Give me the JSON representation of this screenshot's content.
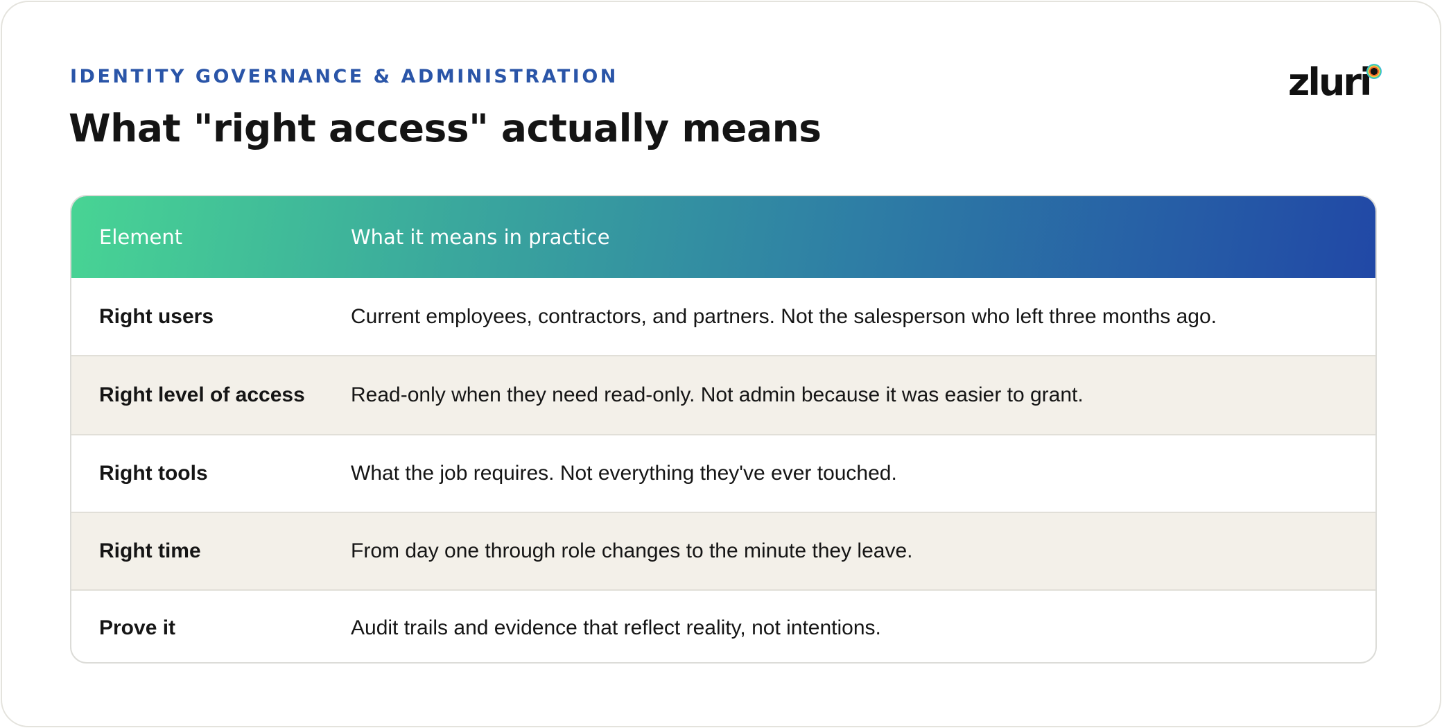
{
  "header": {
    "eyebrow": "IDENTITY GOVERNANCE & ADMINISTRATION",
    "title": "What \"right access\" actually means"
  },
  "logo": {
    "text": "zluri",
    "icon": "zluri-dot-icon",
    "colors": [
      "#111111",
      "#f26b2a",
      "#f9c84b",
      "#46d49a",
      "#3ab6e8"
    ]
  },
  "table": {
    "columns": [
      "Element",
      "What it means in practice"
    ],
    "rows": [
      {
        "element": "Right users",
        "meaning": "Current employees, contractors, and partners. Not the salesperson who left three months ago."
      },
      {
        "element": "Right level of access",
        "meaning": "Read-only when they need read-only. Not admin because it was easier to grant."
      },
      {
        "element": "Right tools",
        "meaning": "What the job requires. Not everything they've ever touched."
      },
      {
        "element": "Right time",
        "meaning": "From day one through role changes to the minute they leave."
      },
      {
        "element": "Prove it",
        "meaning": "Audit trails and evidence that reflect reality, not intentions."
      }
    ]
  },
  "colors": {
    "accent": "#2a55a8",
    "header_gradient_start": "#48d494",
    "header_gradient_end": "#2148a6",
    "alt_row": "#f3f0e9"
  }
}
